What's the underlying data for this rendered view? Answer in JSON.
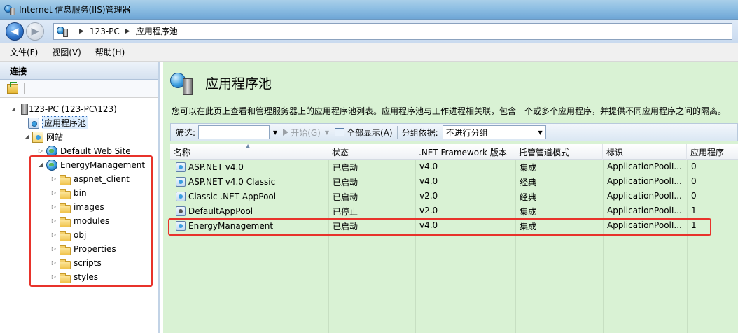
{
  "window": {
    "title": "Internet 信息服务(IIS)管理器"
  },
  "address": {
    "crumbs": [
      "123-PC",
      "应用程序池"
    ]
  },
  "menu": [
    "文件(F)",
    "视图(V)",
    "帮助(H)"
  ],
  "connections": {
    "header": "连接",
    "tree": [
      {
        "label": "123-PC (123-PC\\123)",
        "icon": "server-icon",
        "expander": "◢"
      },
      {
        "label": "应用程序池",
        "icon": "app-pool-icon",
        "expander": ""
      },
      {
        "label": "网站",
        "icon": "sites-icon",
        "expander": "◢"
      },
      {
        "label": "Default Web Site",
        "icon": "globe-icon",
        "expander": "▷"
      },
      {
        "label": "EnergyManagement",
        "icon": "globe-icon",
        "expander": "◢"
      },
      {
        "label": "aspnet_client",
        "icon": "folder-icon",
        "expander": "▷"
      },
      {
        "label": "bin",
        "icon": "folder-icon",
        "expander": "▷"
      },
      {
        "label": "images",
        "icon": "folder-icon",
        "expander": "▷"
      },
      {
        "label": "modules",
        "icon": "folder-icon",
        "expander": "▷"
      },
      {
        "label": "obj",
        "icon": "folder-icon",
        "expander": "▷"
      },
      {
        "label": "Properties",
        "icon": "folder-icon",
        "expander": "▷"
      },
      {
        "label": "scripts",
        "icon": "folder-icon",
        "expander": "▷"
      },
      {
        "label": "styles",
        "icon": "folder-icon",
        "expander": "▷"
      }
    ]
  },
  "main": {
    "title": "应用程序池",
    "description": "您可以在此页上查看和管理服务器上的应用程序池列表。应用程序池与工作进程相关联，包含一个或多个应用程序，并提供不同应用程序之间的隔离。",
    "filter": {
      "label": "筛选:",
      "start": "开始(G)",
      "show_all": "全部显示(A)",
      "group_label": "分组依据:",
      "group_value": "不进行分组"
    },
    "columns": [
      "名称",
      "状态",
      ".NET Framework 版本",
      "托管管道模式",
      "标识",
      "应用程序"
    ],
    "rows": [
      [
        "ASP.NET v4.0",
        "已启动",
        "v4.0",
        "集成",
        "ApplicationPoolI...",
        "0"
      ],
      [
        "ASP.NET v4.0 Classic",
        "已启动",
        "v4.0",
        "经典",
        "ApplicationPoolI...",
        "0"
      ],
      [
        "Classic .NET AppPool",
        "已启动",
        "v2.0",
        "经典",
        "ApplicationPoolI...",
        "0"
      ],
      [
        "DefaultAppPool",
        "已停止",
        "v2.0",
        "集成",
        "ApplicationPoolI...",
        "1"
      ],
      [
        "EnergyManagement",
        "已启动",
        "v4.0",
        "集成",
        "ApplicationPoolI...",
        "1"
      ]
    ]
  },
  "colors": {
    "highlight_box": "#e8332b",
    "main_bg": "#d9f2d4"
  }
}
